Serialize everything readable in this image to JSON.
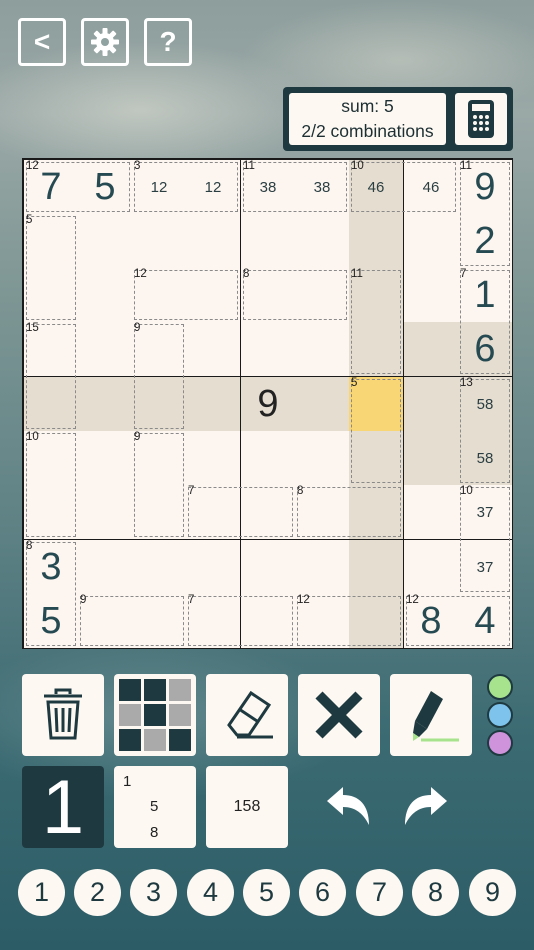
{
  "header": {
    "back_label": "<",
    "help_label": "?"
  },
  "sum_info": {
    "sum_text": "sum: 5",
    "combinations_text": "2/2 combinations"
  },
  "board": {
    "cells": [
      {
        "r": 0,
        "c": 0,
        "value": "7"
      },
      {
        "r": 0,
        "c": 1,
        "value": "5"
      },
      {
        "r": 0,
        "c": 2,
        "cand": "12"
      },
      {
        "r": 0,
        "c": 3,
        "cand": "12"
      },
      {
        "r": 0,
        "c": 4,
        "cand": "38"
      },
      {
        "r": 0,
        "c": 5,
        "cand": "38"
      },
      {
        "r": 0,
        "c": 6,
        "cand": "46"
      },
      {
        "r": 0,
        "c": 7,
        "cand": "46"
      },
      {
        "r": 0,
        "c": 8,
        "value": "9"
      },
      {
        "r": 1,
        "c": 8,
        "value": "2"
      },
      {
        "r": 2,
        "c": 8,
        "value": "1"
      },
      {
        "r": 3,
        "c": 8,
        "value": "6"
      },
      {
        "r": 4,
        "c": 4,
        "value": "9",
        "given": true
      },
      {
        "r": 4,
        "c": 8,
        "cand": "58"
      },
      {
        "r": 5,
        "c": 8,
        "cand": "58"
      },
      {
        "r": 6,
        "c": 8,
        "cand": "37"
      },
      {
        "r": 7,
        "c": 0,
        "value": "3"
      },
      {
        "r": 7,
        "c": 8,
        "cand": "37"
      },
      {
        "r": 8,
        "c": 0,
        "value": "5"
      },
      {
        "r": 8,
        "c": 7,
        "value": "8"
      },
      {
        "r": 8,
        "c": 8,
        "value": "4"
      }
    ],
    "cage_sums": [
      {
        "r": 0,
        "c": 0,
        "sum": "12"
      },
      {
        "r": 0,
        "c": 2,
        "sum": "3"
      },
      {
        "r": 0,
        "c": 4,
        "sum": "11"
      },
      {
        "r": 0,
        "c": 6,
        "sum": "10"
      },
      {
        "r": 0,
        "c": 8,
        "sum": "11"
      },
      {
        "r": 1,
        "c": 0,
        "sum": "5"
      },
      {
        "r": 2,
        "c": 2,
        "sum": "12"
      },
      {
        "r": 2,
        "c": 4,
        "sum": "8"
      },
      {
        "r": 2,
        "c": 6,
        "sum": "11"
      },
      {
        "r": 2,
        "c": 8,
        "sum": "7"
      },
      {
        "r": 3,
        "c": 0,
        "sum": "15"
      },
      {
        "r": 3,
        "c": 2,
        "sum": "9"
      },
      {
        "r": 4,
        "c": 6,
        "sum": "5"
      },
      {
        "r": 4,
        "c": 8,
        "sum": "13"
      },
      {
        "r": 5,
        "c": 0,
        "sum": "10"
      },
      {
        "r": 5,
        "c": 2,
        "sum": "9"
      },
      {
        "r": 6,
        "c": 3,
        "sum": "7"
      },
      {
        "r": 6,
        "c": 5,
        "sum": "8"
      },
      {
        "r": 6,
        "c": 8,
        "sum": "10"
      },
      {
        "r": 7,
        "c": 0,
        "sum": "8"
      },
      {
        "r": 8,
        "c": 1,
        "sum": "9"
      },
      {
        "r": 8,
        "c": 3,
        "sum": "7"
      },
      {
        "r": 8,
        "c": 5,
        "sum": "12"
      },
      {
        "r": 8,
        "c": 7,
        "sum": "12"
      }
    ],
    "selected": {
      "r": 4,
      "c": 6
    },
    "highlight_color": "#e5ddd0",
    "selected_color": "#f8d675",
    "cell_color": "#fdf5ef"
  },
  "modes": {
    "normal_label": "1",
    "corner_top": "1",
    "corner_mid": "5",
    "corner_bot": "8",
    "center_label": "158"
  },
  "colors": {
    "green": "#a6e38c",
    "blue": "#7ec3ec",
    "purple": "#cf93dc"
  },
  "keypad": [
    "1",
    "2",
    "3",
    "4",
    "5",
    "6",
    "7",
    "8",
    "9"
  ]
}
